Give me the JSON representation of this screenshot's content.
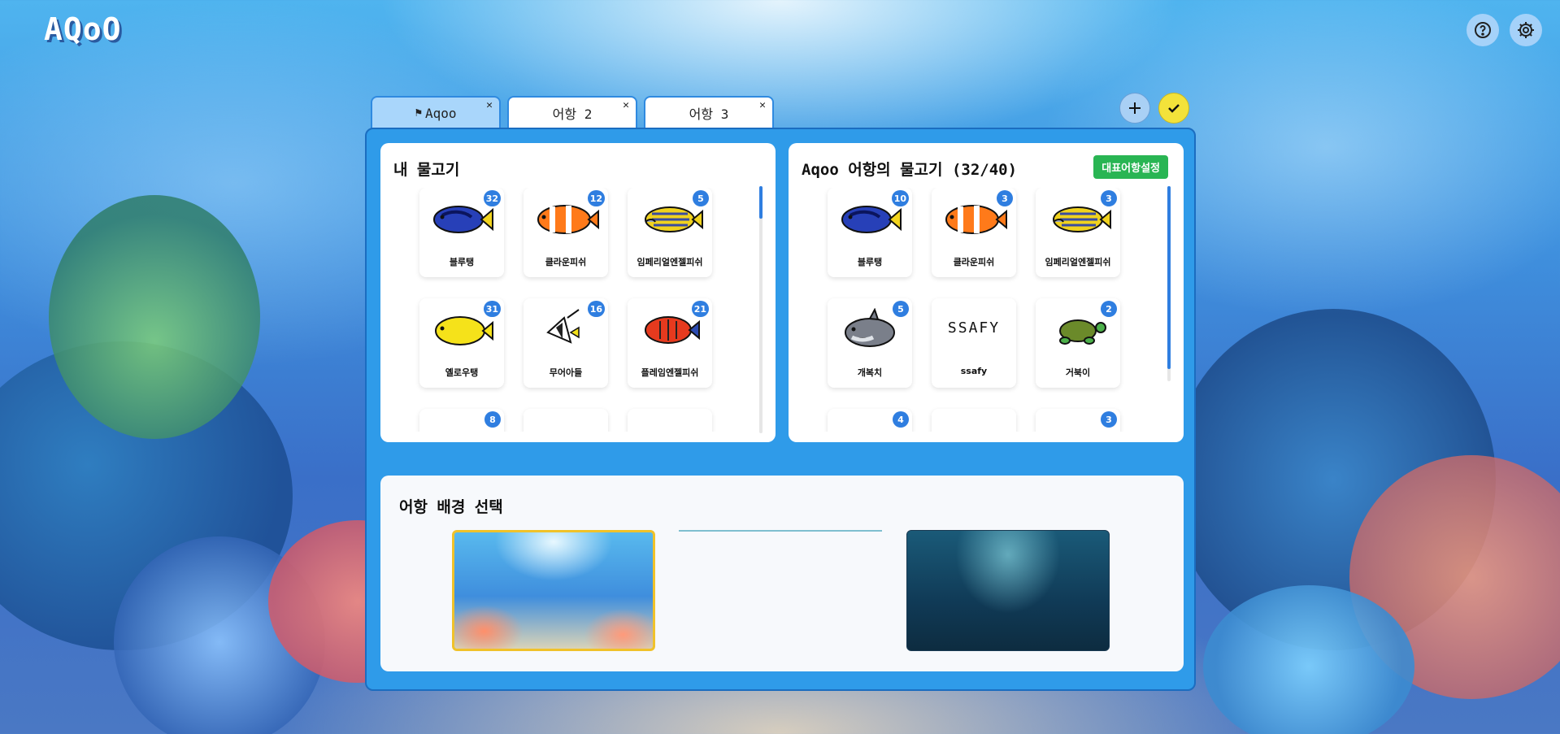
{
  "app": {
    "logo": "AQoO"
  },
  "top_actions": {
    "help_icon": "help-circle-icon",
    "settings_icon": "gear-icon"
  },
  "tabs": [
    {
      "label": "Aqoo",
      "active": true,
      "prefix_icon": "flag-icon"
    },
    {
      "label": "어항 2",
      "active": false
    },
    {
      "label": "어항 3",
      "active": false
    }
  ],
  "tab_actions": {
    "add_icon": "plus-icon",
    "confirm_icon": "check-icon"
  },
  "my_fish": {
    "title": "내 물고기",
    "items": [
      {
        "name": "블루탱",
        "count": "32",
        "icon": "blue-tang-fish-icon"
      },
      {
        "name": "클라운피쉬",
        "count": "12",
        "icon": "clownfish-icon"
      },
      {
        "name": "임페리얼엔젤피쉬",
        "count": "5",
        "icon": "imperial-angelfish-icon"
      },
      {
        "name": "옐로우탱",
        "count": "31",
        "icon": "yellow-tang-fish-icon"
      },
      {
        "name": "무어아들",
        "count": "16",
        "icon": "moorish-idol-fish-icon"
      },
      {
        "name": "플레임엔젤피쉬",
        "count": "21",
        "icon": "flame-angelfish-icon"
      },
      {
        "name": "",
        "count": "8",
        "icon": "fish-icon"
      },
      {
        "name": "",
        "count": "",
        "icon": "fish-icon"
      },
      {
        "name": "",
        "count": "",
        "icon": "fish-icon"
      }
    ]
  },
  "aquarium_fish": {
    "title": "Aqoo 어항의 물고기 (32/40)",
    "set_rep_button": "대표어항설정",
    "items": [
      {
        "name": "블루탱",
        "count": "10",
        "icon": "blue-tang-fish-icon"
      },
      {
        "name": "클라운피쉬",
        "count": "3",
        "icon": "clownfish-icon"
      },
      {
        "name": "임페리얼엔젤피쉬",
        "count": "3",
        "icon": "imperial-angelfish-icon"
      },
      {
        "name": "개복치",
        "count": "5",
        "icon": "sunfish-icon"
      },
      {
        "name": "ssafy",
        "count": "",
        "icon": "ssafy-text-drawing-icon",
        "drawing_text": "SSAFY"
      },
      {
        "name": "거북이",
        "count": "2",
        "icon": "turtle-icon"
      },
      {
        "name": "",
        "count": "4",
        "icon": "fish-icon"
      },
      {
        "name": "",
        "count": "",
        "icon": "fish-icon"
      },
      {
        "name": "",
        "count": "3",
        "icon": "fish-icon"
      }
    ]
  },
  "background_select": {
    "title": "어항 배경 선택",
    "options": [
      {
        "name": "bright-reef",
        "selected": true
      },
      {
        "name": "loading",
        "selected": false
      },
      {
        "name": "deep-sea",
        "selected": false
      }
    ]
  },
  "colors": {
    "accent": "#2f9be9",
    "badge": "#2f7ee0",
    "rep_button": "#29b553",
    "confirm": "#f3e23a",
    "selected_border": "#f0c22a"
  }
}
